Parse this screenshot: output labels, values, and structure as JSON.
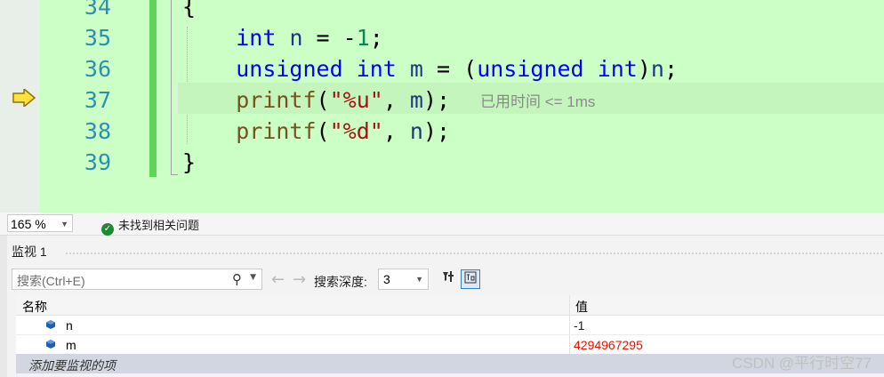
{
  "editor": {
    "lines": [
      {
        "num": "34",
        "code": "{"
      },
      {
        "num": "35",
        "code": "int n = -1;"
      },
      {
        "num": "36",
        "code": "unsigned int m = (unsigned int)n;"
      },
      {
        "num": "37",
        "code": "printf(\"%u\", m);"
      },
      {
        "num": "38",
        "code": "printf(\"%d\", n);"
      },
      {
        "num": "39",
        "code": "}"
      }
    ],
    "elapsed_hint": "已用时间 <= 1ms",
    "current_line_icon": "execution-arrow-icon"
  },
  "status": {
    "zoom": "165 %",
    "issues": "未找到相关问题",
    "check_icon": "check-circle-icon"
  },
  "watch": {
    "title": "监视 1",
    "search_placeholder": "搜索(Ctrl+E)",
    "depth_label": "搜索深度:",
    "depth_value": "3",
    "col_name": "名称",
    "col_value": "值",
    "rows": [
      {
        "name": "n",
        "value": "-1",
        "value_color": "#1e1e1e"
      },
      {
        "name": "m",
        "value": "4294967295",
        "value_color": "#e51400"
      }
    ],
    "add_row": "添加要监视的项"
  },
  "watermark": "CSDN @平行时空77"
}
